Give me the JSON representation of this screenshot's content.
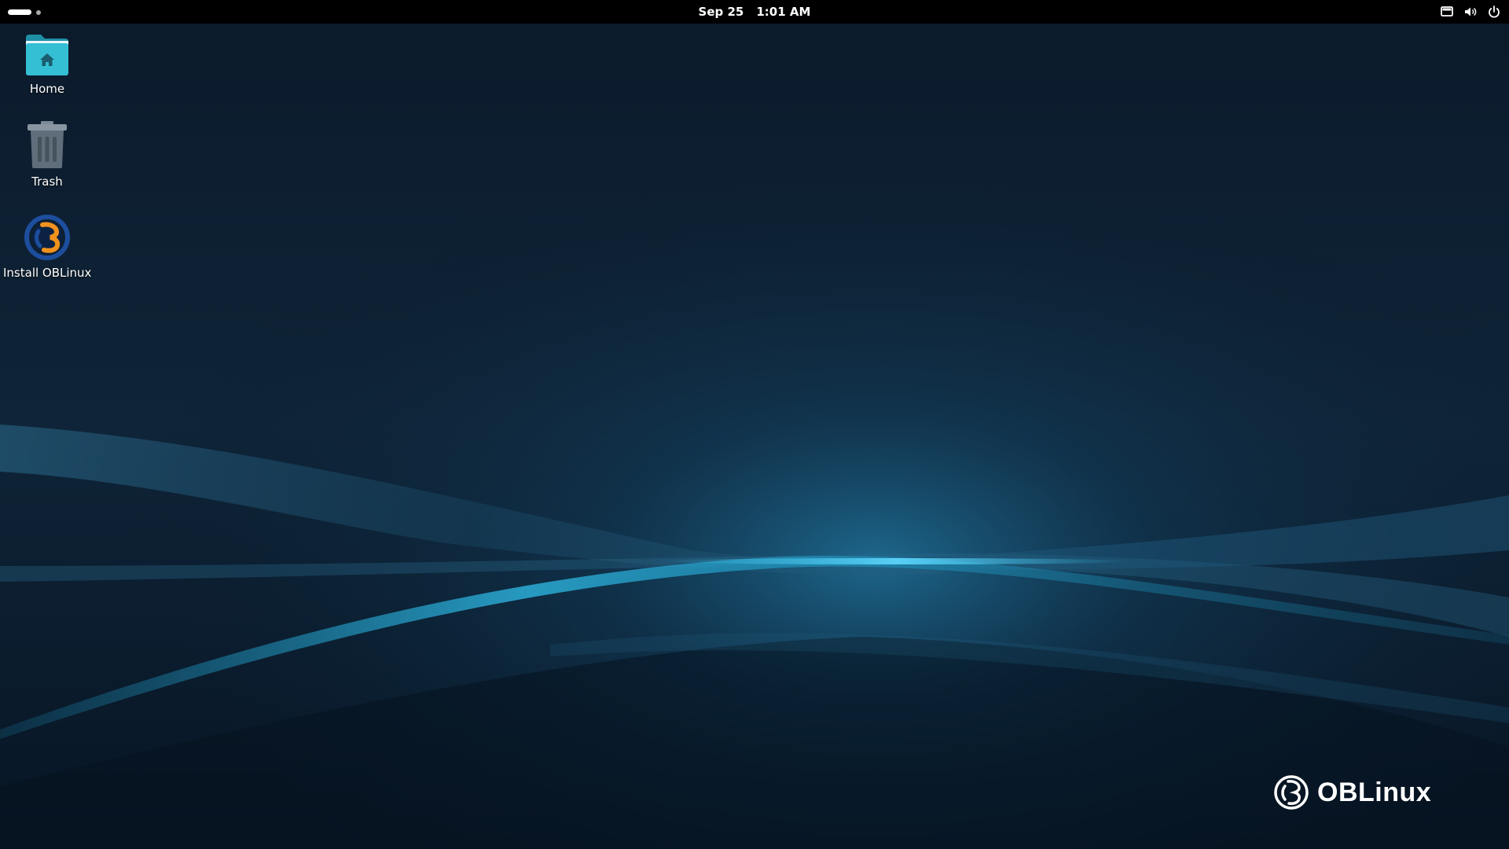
{
  "topbar": {
    "date": "Sep 25",
    "time": "1:01 AM",
    "tray_icons": [
      "screen-icon",
      "volume-icon",
      "power-icon"
    ]
  },
  "desktop": {
    "icons": [
      {
        "label": "Home",
        "icon": "home-folder-icon"
      },
      {
        "label": "Trash",
        "icon": "trash-icon"
      },
      {
        "label": "Install OBLinux",
        "icon": "oblinux-installer-icon"
      }
    ]
  },
  "wallpaper": {
    "brand_text": "OBLinux",
    "accent_color": "#34b6e0",
    "background_color": "#0a1a2b"
  },
  "colors": {
    "folder": "#34bfd4",
    "folder_dark": "#1f8fa5",
    "trash": "#5f6e7a",
    "logo_blue": "#1d4e9e",
    "logo_orange": "#f0921d"
  }
}
